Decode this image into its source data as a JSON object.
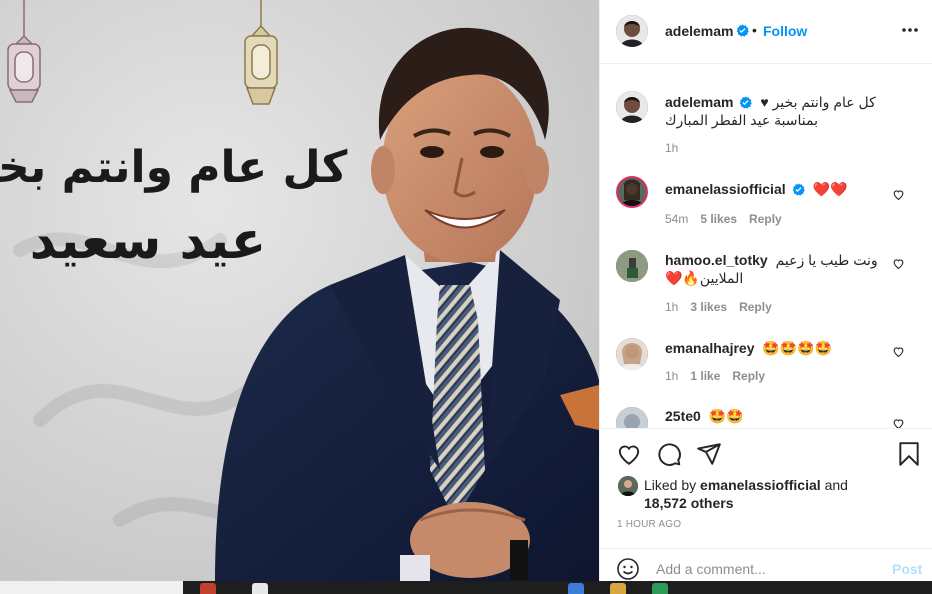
{
  "post": {
    "author": "adelemam",
    "follow_label": "Follow",
    "dot": "•",
    "caption_line1": "كل عام وانتم بخير ♥",
    "caption_line2": "بمناسبة عيد الفطر المبارك",
    "caption_time": "1h",
    "image_calligraphy_line1": "كل عام وانتم بخير",
    "image_calligraphy_line2": "عيد سعيد"
  },
  "comments": [
    {
      "user": "emanelassiofficial",
      "text": "❤️❤️",
      "time": "54m",
      "likes": "5 likes",
      "reply": "Reply"
    },
    {
      "user": "hamoo.el_totky",
      "text": "ونت طيب يا زعيم الملايين🔥❤️",
      "time": "1h",
      "likes": "3 likes",
      "reply": "Reply"
    },
    {
      "user": "emanalhajrey",
      "text": "🤩🤩🤩🤩",
      "time": "1h",
      "likes": "1 like",
      "reply": "Reply"
    },
    {
      "user": "25te0",
      "text": "🤩🤩",
      "time": "",
      "likes": "",
      "reply": ""
    }
  ],
  "likes": {
    "prefix": "Liked by",
    "user": "emanelassiofficial",
    "and": "and",
    "others": "18,572 others"
  },
  "timestamp": "1 HOUR AGO",
  "add_comment": {
    "placeholder": "Add a comment...",
    "post_label": "Post"
  },
  "colors": {
    "accent": "#0095f6",
    "post_disabled": "#b2dffc",
    "heart": "#ed4956",
    "muted": "#8e8e8e"
  },
  "icons": [
    "verified-icon",
    "more-icon",
    "heart-icon",
    "comment-icon",
    "share-icon",
    "bookmark-icon",
    "emoji-icon"
  ]
}
